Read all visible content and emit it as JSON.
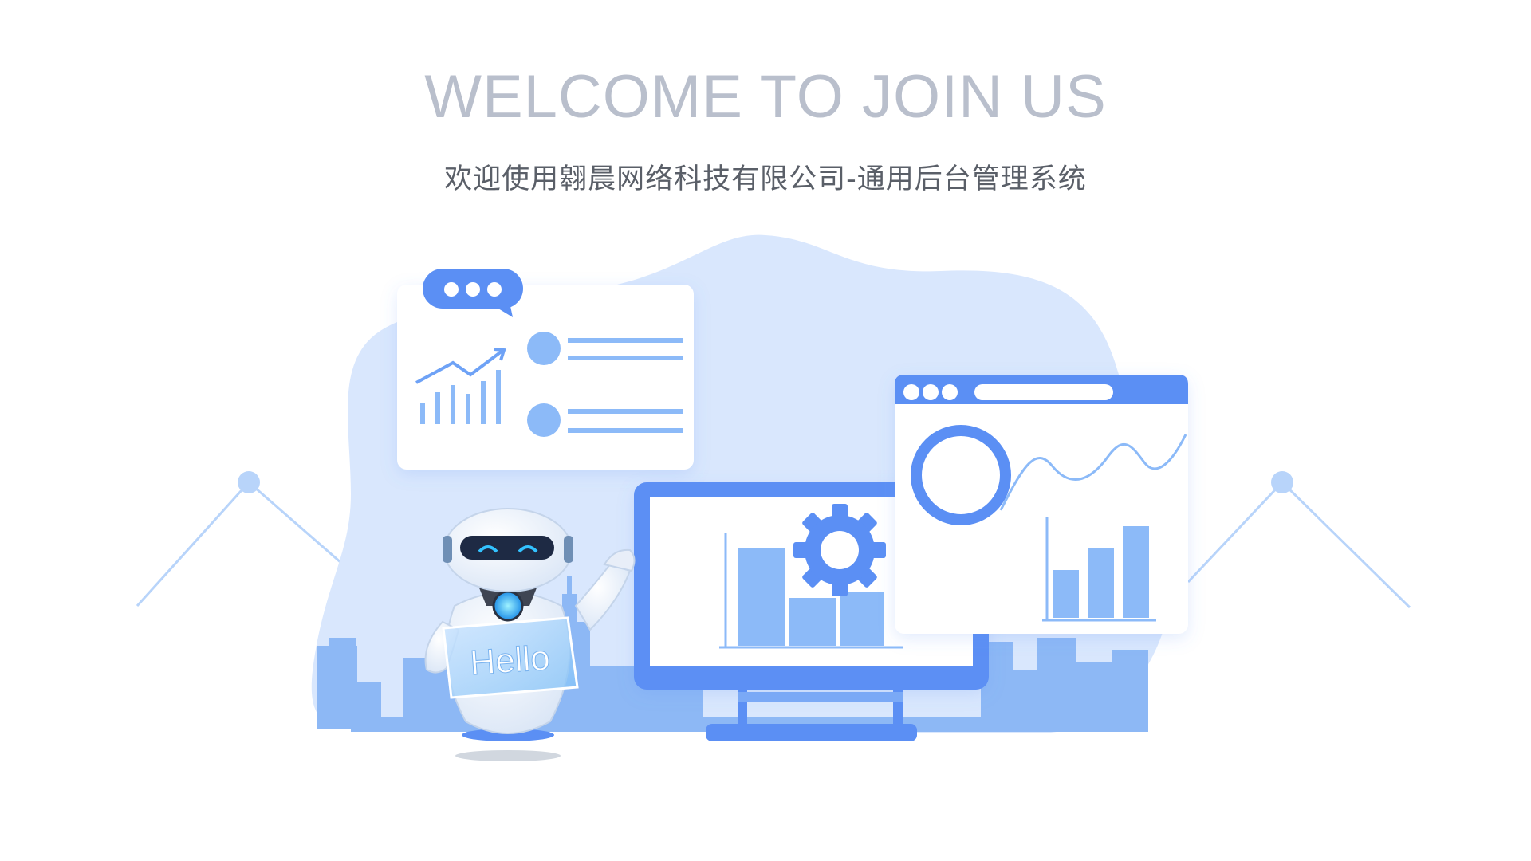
{
  "header": {
    "headline": "WELCOME TO JOIN US",
    "subtitle": "欢迎使用翱晨网络科技有限公司-通用后台管理系统"
  },
  "illustration": {
    "robot_sign": "Hello",
    "palette": {
      "primary": "#5b8ff4",
      "light": "#8cbaf8",
      "blob": "#d9e7fd",
      "skyline": "#8db8f5",
      "headline_text": "#b9bfcc",
      "subtitle_text": "#5a5f68"
    }
  }
}
